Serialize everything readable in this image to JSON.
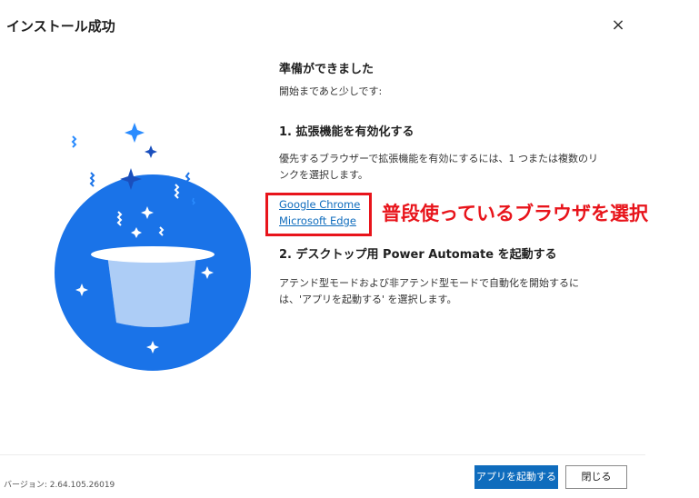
{
  "dialog": {
    "title": "インストール成功",
    "close_symbol": "×"
  },
  "content": {
    "ready_heading": "準備ができました",
    "ready_sub": "開始まであと少しです:",
    "step1_heading": "1. 拡張機能を有効化する",
    "step1_text": "優先するブラウザーで拡張機能を有効にするには、1 つまたは複数のリンクを選択します。",
    "browser_links": [
      "Google Chrome",
      "Microsoft Edge"
    ],
    "step2_heading": "2. デスクトップ用 Power Automate を起動する",
    "step2_text": "アテンド型モードおよび非アテンド型モードで自動化を開始するには、'アプリを起動する' を選択します。"
  },
  "annotation": {
    "text": "普段使っているブラウザを選択",
    "color": "#e8141b"
  },
  "footer": {
    "version": "バージョン: 2.64.105.26019",
    "launch_app_label": "アプリを起動する",
    "close_label": "閉じる"
  },
  "colors": {
    "accent": "#0f6cbd",
    "illustration_blue": "#1a73e8"
  },
  "icons": {
    "close": "close-icon",
    "illustration": "magic-hat-illustration"
  }
}
